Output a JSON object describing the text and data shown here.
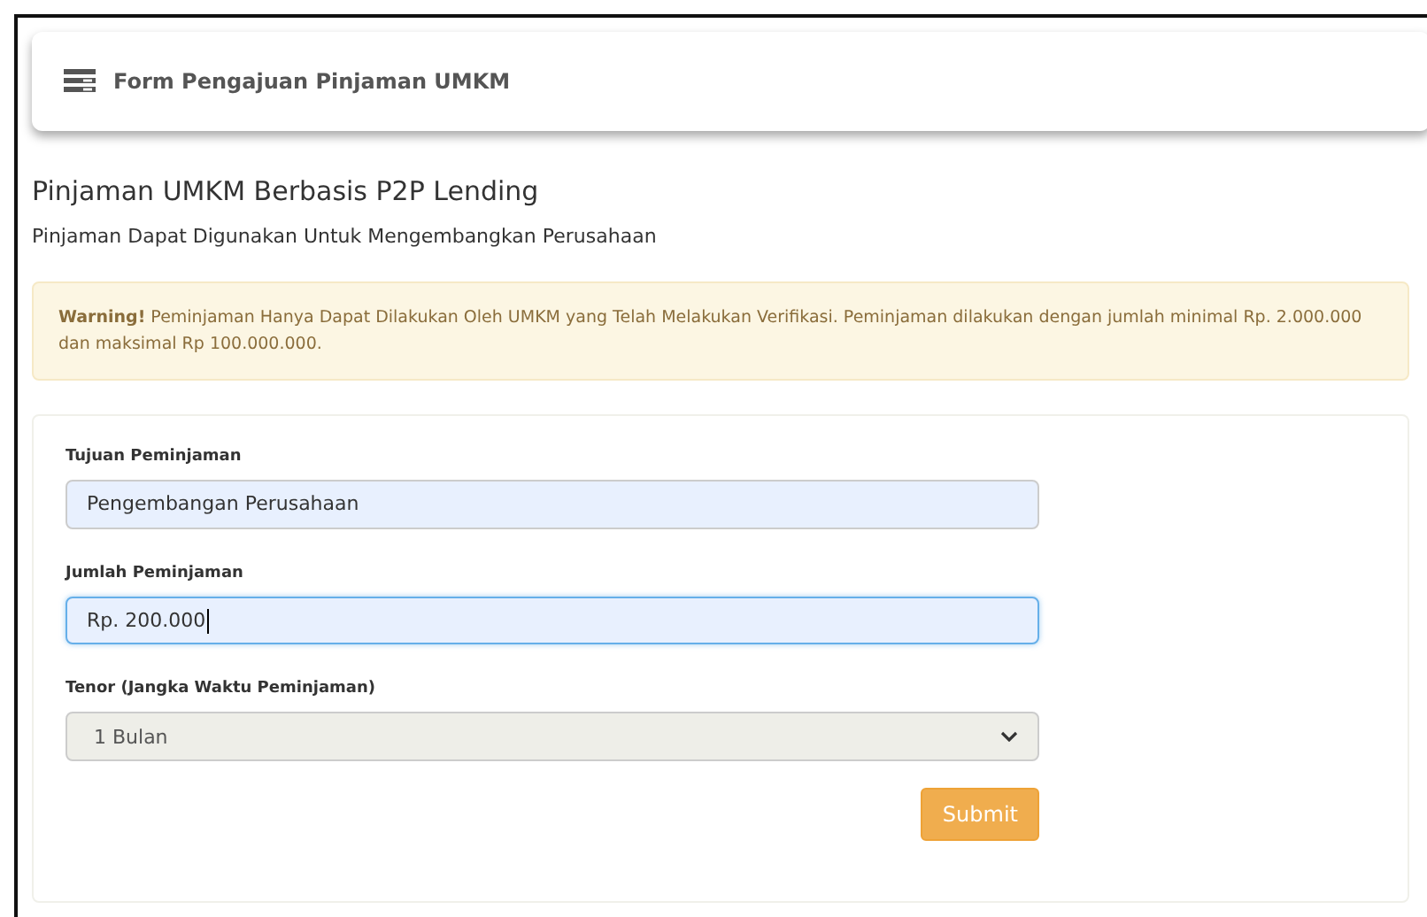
{
  "header": {
    "title": "Form Pengajuan Pinjaman UMKM"
  },
  "heading": "Pinjaman UMKM Berbasis P2P Lending",
  "subheading": "Pinjaman Dapat Digunakan Untuk Mengembangkan Perusahaan",
  "alert": {
    "text": "**Warning!** Peminjaman Hanya Dapat Dilakukan Oleh UMKM yang Telah Melakukan Verifikasi. Peminjaman dilakukan dengan jumlah minimal Rp. 2.000.000 dan maksimal Rp 100.000.000."
  },
  "fields": [
    {
      "kind": "text",
      "label": "Tujuan Peminjaman",
      "value": "Pengembangan Perusahaan",
      "focused": false
    },
    {
      "kind": "text",
      "label": "Jumlah Peminjaman",
      "value": "Rp. 200.000",
      "focused": true
    },
    {
      "kind": "select",
      "label": "Tenor (Jangka Waktu Peminjaman)",
      "value": "1 Bulan",
      "focused": false
    }
  ],
  "submit": "Submit"
}
